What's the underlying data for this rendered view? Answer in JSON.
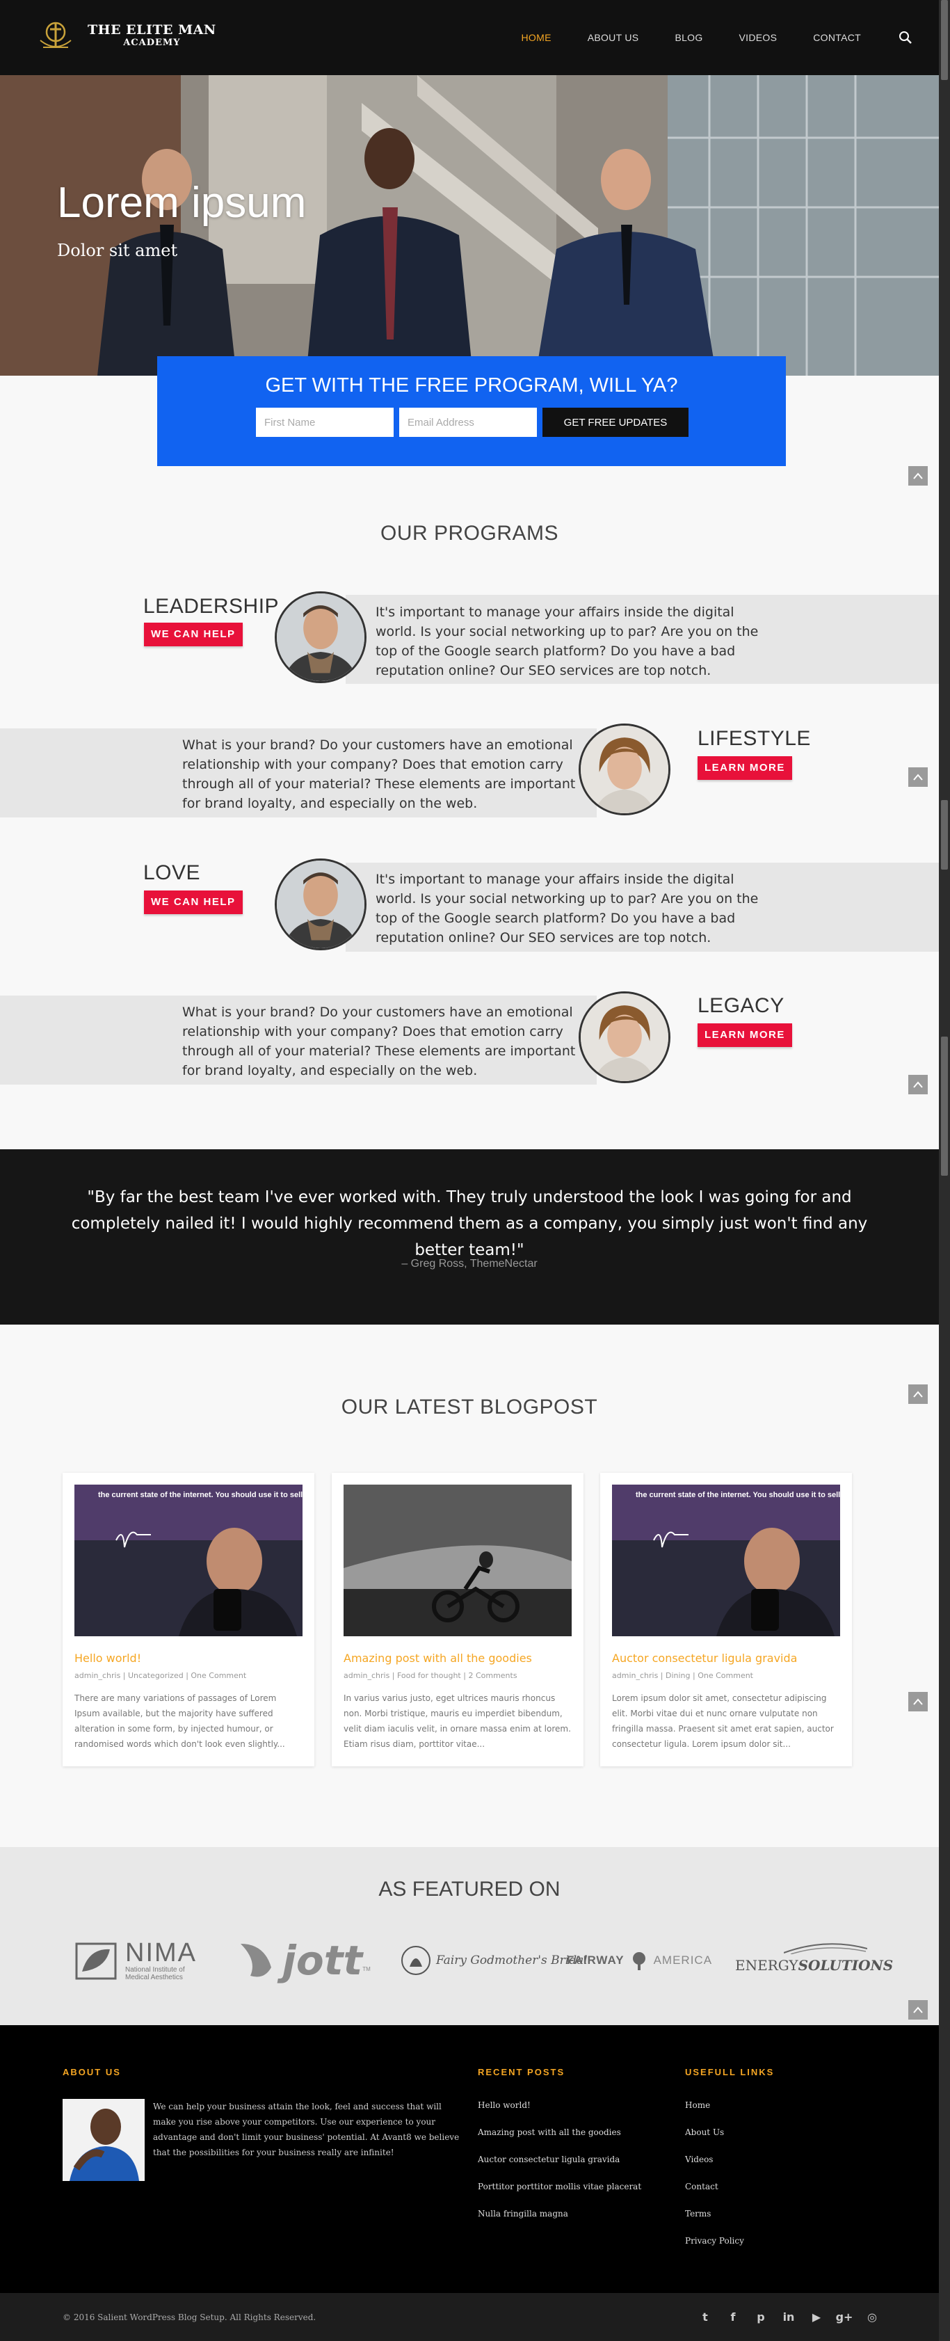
{
  "header": {
    "logo_line1": "THE ELITE MAN",
    "logo_line2": "ACADEMY",
    "nav": [
      "HOME",
      "ABOUT US",
      "BLOG",
      "VIDEOS",
      "CONTACT"
    ],
    "active_nav": "HOME",
    "accent": "#f5a623"
  },
  "hero": {
    "title": "Lorem ipsum",
    "subtitle": "Dolor sit amet"
  },
  "optin": {
    "title": "GET WITH THE FREE PROGRAM, WILL YA?",
    "first_name_placeholder": "First Name",
    "email_placeholder": "Email Address",
    "button": "GET FREE UPDATES",
    "bg": "#1163f1"
  },
  "programs": {
    "title": "OUR PROGRAMS",
    "items": [
      {
        "name": "LEADERSHIP",
        "button": "WE CAN HELP",
        "text": "It's important to manage your affairs inside the digital world. Is your social networking up to par? Are you on the top of the Google search platform? Do you have a bad reputation online? Our SEO services are top notch."
      },
      {
        "name": "LIFESTYLE",
        "button": "LEARN MORE",
        "text": "What is your brand? Do your customers have an emotional relationship with your company? Does that emotion carry through all of your material? These elements are important for brand loyalty, and especially on the web."
      },
      {
        "name": "LOVE",
        "button": "WE CAN HELP",
        "text": "It's important to manage your affairs inside the digital world. Is your social networking up to par? Are you on the top of the Google search platform? Do you have a bad reputation online? Our SEO services are top notch."
      },
      {
        "name": "LEGACY",
        "button": "LEARN MORE",
        "text": "What is your brand? Do your customers have an emotional relationship with your company? Does that emotion carry through all of your material? These elements are important for brand loyalty, and especially on the web."
      }
    ],
    "button_color": "#e8113a"
  },
  "testimonial": {
    "quote": "\"By far the best team I've ever worked with. They truly understood the look I was going for and completely nailed it! I would highly recommend them as a company, you simply just won't find any better team!\"",
    "author": "– Greg Ross, ThemeNectar"
  },
  "blog": {
    "title": "OUR LATEST BLOGPOST",
    "image_caption": "the current state of the internet. You should use it to sell stuff.",
    "posts": [
      {
        "title": "Hello world!",
        "meta": "admin_chris | Uncategorized | One Comment",
        "excerpt": "There are many variations of passages of Lorem Ipsum available, but the majority have suffered alteration in some form, by injected humour, or randomised words which don't look even slightly..."
      },
      {
        "title": "Amazing post with all the goodies",
        "meta": "admin_chris | Food for thought | 2 Comments",
        "excerpt": "In varius varius justo, eget ultrices mauris rhoncus non. Morbi tristique, mauris eu imperdiet bibendum, velit diam iaculis velit, in ornare massa enim at lorem. Etiam risus diam, porttitor vitae..."
      },
      {
        "title": "Auctor consectetur ligula gravida",
        "meta": "admin_chris | Dining | One Comment",
        "excerpt": "Lorem ipsum dolor sit amet, consectetur adipiscing elit. Morbi vitae dui et nunc ornare vulputate non fringilla massa. Praesent sit amet erat sapien, auctor consectetur ligula. Lorem ipsum dolor sit..."
      }
    ]
  },
  "featured": {
    "title": "AS FEATURED ON",
    "logos": {
      "nima": "NIMA",
      "nima_sub1": "National Institute of",
      "nima_sub2": "Medical Aesthetics",
      "jott": "jott",
      "jott_tm": "TM",
      "fairy": "Fairy Godmother's Bridal",
      "fairway_left": "FAIRWAY",
      "fairway_right": "AMERICA",
      "energy_a": "ENERGY",
      "energy_b": "SOLUTIONS"
    }
  },
  "footer": {
    "about_heading": "ABOUT US",
    "about_text": "We can help your business attain the look, feel and success that will make you rise above your competitors. Use our experience to your advantage and don't limit your business' potential. At Avant8 we believe that the possibilities for your business really are infinite!",
    "recent_heading": "RECENT POSTS",
    "recent": [
      "Hello world!",
      "Amazing post with all the goodies",
      "Auctor consectetur ligula gravida",
      "Porttitor porttitor mollis vitae placerat",
      "Nulla fringilla magna"
    ],
    "links_heading": "USEFULL LINKS",
    "links": [
      "Home",
      "About Us",
      "Videos",
      "Contact",
      "Terms",
      "Privacy Policy"
    ],
    "copyright": "© 2016 Salient WordPress Blog Setup. All Rights Reserved.",
    "social_icons": [
      "twitter-icon",
      "facebook-icon",
      "pinterest-icon",
      "linkedin-icon",
      "youtube-icon",
      "google-plus-icon",
      "instagram-icon"
    ],
    "social_glyphs": [
      "t",
      "f",
      "p",
      "in",
      "▶",
      "g+",
      "◎"
    ]
  }
}
